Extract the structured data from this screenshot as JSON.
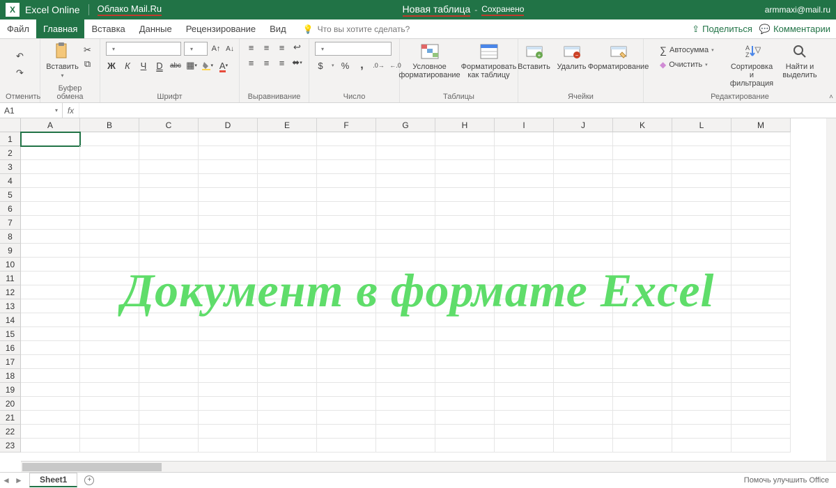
{
  "titlebar": {
    "app_name": "Excel Online",
    "cloud_name": "Облако Mail.Ru",
    "doc_name": "Новая таблица",
    "dash": "-",
    "saved_status": "Сохранено",
    "user_email": "armmaxi@mail.ru"
  },
  "tabs": {
    "file": "Файл",
    "home": "Главная",
    "insert": "Вставка",
    "data": "Данные",
    "review": "Рецензирование",
    "view": "Вид",
    "tellme_placeholder": "Что вы хотите сделать?",
    "share": "Поделиться",
    "comments": "Комментарии"
  },
  "ribbon": {
    "undo_group": "Отменить",
    "clipboard": {
      "paste": "Вставить",
      "group": "Буфер обмена"
    },
    "font": {
      "group": "Шрифт",
      "bold": "Ж",
      "italic": "К",
      "underline": "Ч",
      "dstrike": "D",
      "strike": "abc"
    },
    "alignment": {
      "group": "Выравнивание"
    },
    "number": {
      "group": "Число",
      "dollar": "$",
      "percent": "%",
      "comma": ",",
      "dec_inc": ".00",
      "dec_dec": ".0"
    },
    "tables": {
      "group": "Таблицы",
      "cond": "Условное форматирование",
      "format_as": "Форматировать как таблицу"
    },
    "cells": {
      "group": "Ячейки",
      "insert": "Вставить",
      "delete": "Удалить",
      "format": "Форматирование"
    },
    "editing": {
      "group": "Редактирование",
      "autosum": "Автосумма",
      "clear": "Очистить",
      "sort": "Сортировка и фильтрация",
      "find": "Найти и выделить"
    }
  },
  "formulabar": {
    "namebox": "A1",
    "fx": "fx"
  },
  "grid": {
    "columns": [
      "A",
      "B",
      "C",
      "D",
      "E",
      "F",
      "G",
      "H",
      "I",
      "J",
      "K",
      "L",
      "M"
    ],
    "rows": [
      "1",
      "2",
      "3",
      "4",
      "5",
      "6",
      "7",
      "8",
      "9",
      "10",
      "11",
      "12",
      "13",
      "14",
      "15",
      "16",
      "17",
      "18",
      "19",
      "20",
      "21",
      "22",
      "23"
    ],
    "selected": "A1",
    "watermark": "Документ в формате Excel"
  },
  "sheetbar": {
    "sheet_name": "Sheet1",
    "help_link": "Помочь улучшить Office"
  }
}
